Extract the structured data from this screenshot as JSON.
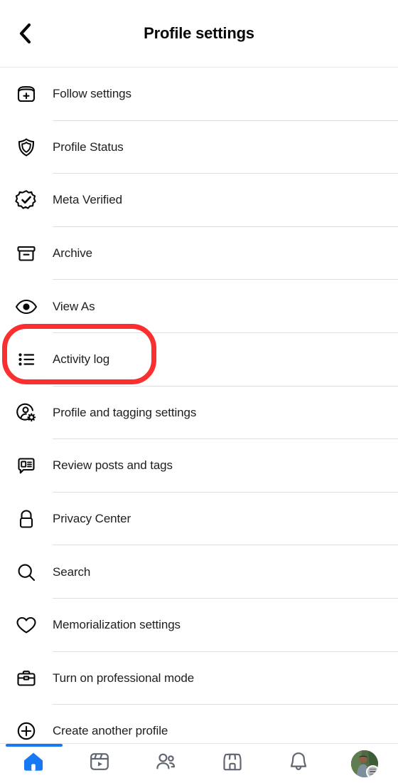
{
  "header": {
    "title": "Profile settings",
    "back_icon": "chevron-left-icon"
  },
  "list": {
    "items": [
      {
        "label": "Follow settings",
        "icon": "archive-box-plus-icon"
      },
      {
        "label": "Profile Status",
        "icon": "shield-icon"
      },
      {
        "label": "Meta Verified",
        "icon": "verified-badge-icon"
      },
      {
        "label": "Archive",
        "icon": "archive-icon"
      },
      {
        "label": "View As",
        "icon": "eye-icon"
      },
      {
        "label": "Activity log",
        "icon": "list-bullet-icon"
      },
      {
        "label": "Profile and tagging settings",
        "icon": "person-gear-icon"
      },
      {
        "label": "Review posts and tags",
        "icon": "comment-list-icon"
      },
      {
        "label": "Privacy Center",
        "icon": "lock-icon"
      },
      {
        "label": "Search",
        "icon": "search-icon"
      },
      {
        "label": "Memorialization settings",
        "icon": "heart-icon"
      },
      {
        "label": "Turn on professional mode",
        "icon": "briefcase-icon"
      },
      {
        "label": "Create another profile",
        "icon": "plus-circle-icon"
      }
    ]
  },
  "annotation": {
    "target_label": "Activity log",
    "color": "#fa2f2f",
    "shape": "rounded-rectangle-outline"
  },
  "bottom_nav": {
    "active_index": 0,
    "active_color": "#1877f2",
    "inactive_color": "#606770",
    "items": [
      {
        "name": "home",
        "icon": "home-icon"
      },
      {
        "name": "video",
        "icon": "reels-video-icon"
      },
      {
        "name": "friends",
        "icon": "friends-icon"
      },
      {
        "name": "marketplace",
        "icon": "marketplace-store-icon"
      },
      {
        "name": "notifications",
        "icon": "bell-icon"
      },
      {
        "name": "menu",
        "icon": "profile-avatar-menu-icon"
      }
    ]
  }
}
